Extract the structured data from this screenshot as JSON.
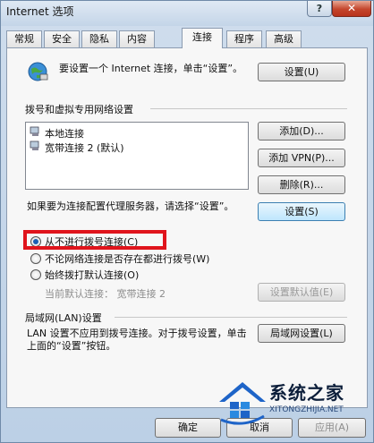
{
  "window": {
    "title": "Internet 选项",
    "help_label": "?",
    "close_label": "✕"
  },
  "tabs": [
    {
      "label": "常规"
    },
    {
      "label": "安全"
    },
    {
      "label": "隐私"
    },
    {
      "label": "内容"
    },
    {
      "label": "连接",
      "active": true
    },
    {
      "label": "程序"
    },
    {
      "label": "高级"
    }
  ],
  "setup": {
    "text": "要设置一个 Internet 连接，单击“设置”。",
    "button_label": "设置(U)"
  },
  "dialup": {
    "group_label": "拨号和虚拟专用网络设置",
    "connections": [
      {
        "label": "本地连接"
      },
      {
        "label": "宽带连接 2 (默认)"
      }
    ],
    "add_label": "添加(D)...",
    "add_vpn_label": "添加 VPN(P)...",
    "delete_label": "删除(R)...",
    "proxy_text": "如果要为连接配置代理服务器，请选择“设置”。",
    "settings_label": "设置(S)",
    "options": [
      {
        "label": "从不进行拨号连接(C)",
        "checked": true
      },
      {
        "label": "不论网络连接是否存在都进行拨号(W)",
        "checked": false
      },
      {
        "label": "始终拨打默认连接(O)",
        "checked": false
      }
    ],
    "current_default_label": "当前默认连接：",
    "current_default_value": "宽带连接 2",
    "set_default_label": "设置默认值(E)"
  },
  "lan": {
    "group_label": "局域网(LAN)设置",
    "text": "LAN 设置不应用到拨号连接。对于拨号设置，单击上面的“设置”按钮。",
    "button_label": "局域网设置(L)"
  },
  "footer": {
    "ok_label": "确定",
    "cancel_label": "取消",
    "apply_label": "应用(A)"
  },
  "watermark": {
    "brand": "系统之家",
    "url": "XITONGZHIJIA.NET"
  }
}
